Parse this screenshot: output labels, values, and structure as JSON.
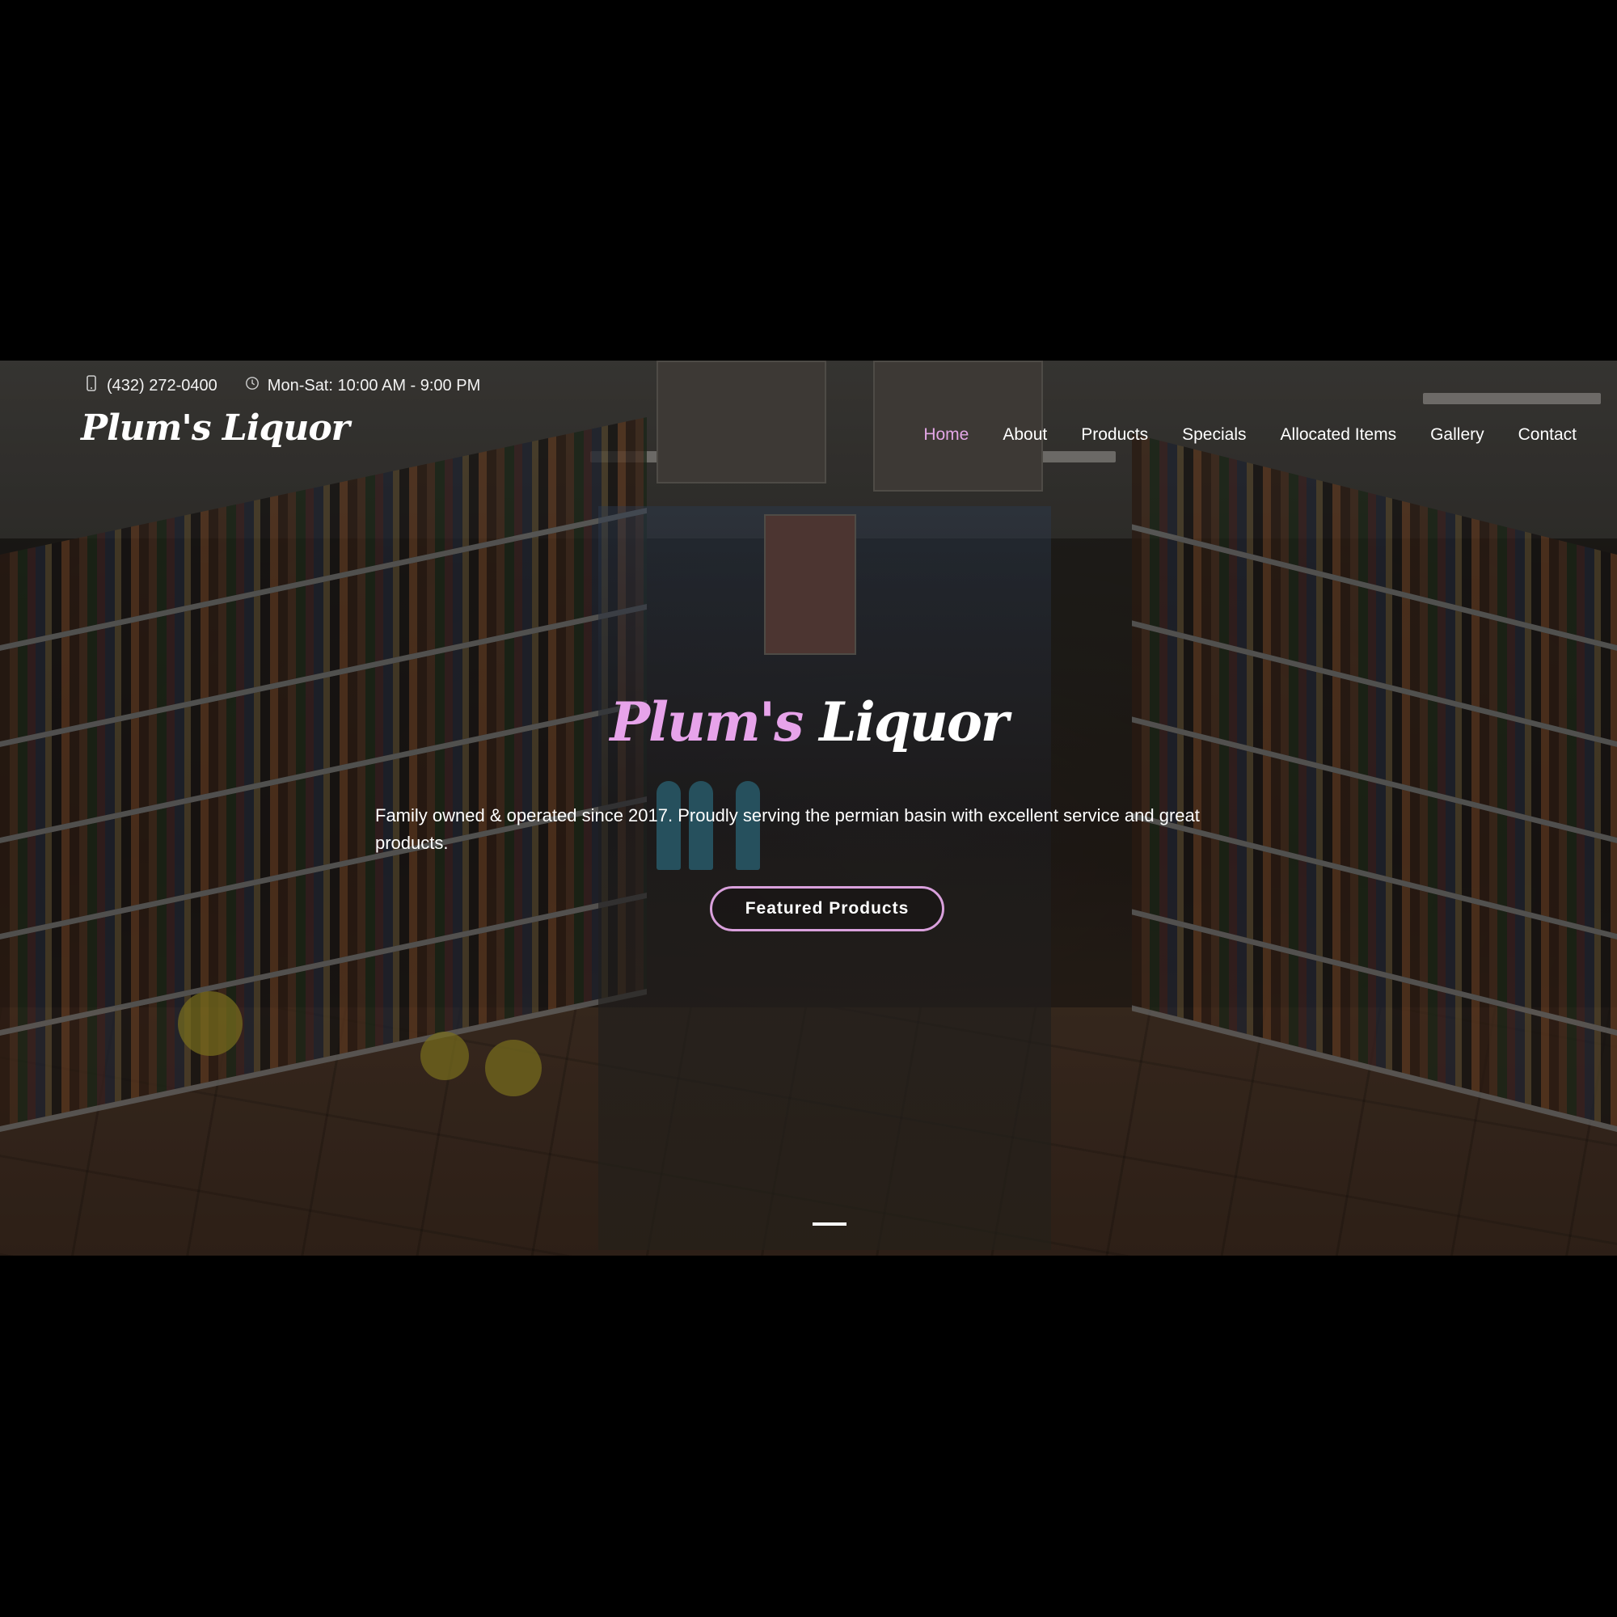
{
  "topbar": {
    "phone": "(432) 272-0400",
    "phone_icon": "mobile-phone-icon",
    "hours": "Mon-Sat: 10:00 AM - 9:00 PM",
    "hours_icon": "clock-icon"
  },
  "brand": {
    "logo": "Plum's Liquor"
  },
  "nav": {
    "items": [
      {
        "label": "Home",
        "active": true
      },
      {
        "label": "About"
      },
      {
        "label": "Products"
      },
      {
        "label": "Specials"
      },
      {
        "label": "Allocated Items"
      },
      {
        "label": "Gallery"
      },
      {
        "label": "Contact"
      }
    ]
  },
  "hero": {
    "title_part1": "Plum's",
    "title_part2": "Liquor",
    "tagline": "Family owned & operated since 2017. Proudly serving the permian basin with excellent service and great products.",
    "cta": "Featured Products"
  },
  "colors": {
    "accent": "#e3a6e6",
    "button_border": "#d9a0dc",
    "background": "#000000"
  }
}
